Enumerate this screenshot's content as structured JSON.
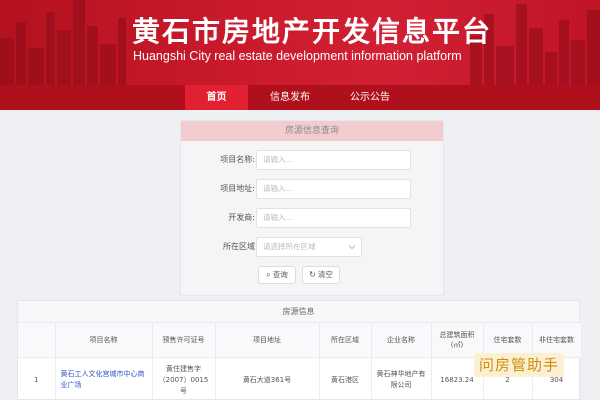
{
  "header": {
    "title": "黄石市房地产开发信息平台",
    "subtitle": "Huangshi City real estate development information platform"
  },
  "nav": {
    "items": [
      {
        "label": "首页",
        "active": true
      },
      {
        "label": "信息发布",
        "active": false
      },
      {
        "label": "公示公告",
        "active": false
      }
    ]
  },
  "search": {
    "title": "房源信息查询",
    "fields": [
      {
        "label": "项目名称:",
        "placeholder": "请输入..."
      },
      {
        "label": "项目地址:",
        "placeholder": "请输入..."
      },
      {
        "label": "开发商:",
        "placeholder": "请输入..."
      }
    ],
    "region": {
      "label": "所在区域",
      "placeholder": "请选择所在区域"
    },
    "query_button": "查询",
    "clear_button": "清空"
  },
  "results": {
    "title": "房源信息",
    "columns": [
      "",
      "项目名称",
      "预售许可证号",
      "项目地址",
      "所在区域",
      "企业名称",
      "总建筑面积(㎡)",
      "住宅套数",
      "非住宅套数"
    ],
    "rows": [
      {
        "index": "1",
        "name": "黄石工人文化宫城市中心商业广场",
        "license": "黄住建售字（2007）0015号",
        "address": "黄石大道361号",
        "district": "黄石港区",
        "company": "黄石神华地产有限公司",
        "area": "16823.24",
        "residential": "2",
        "non_residential": "304"
      }
    ]
  },
  "watermark": {
    "label": "问房管助手"
  },
  "colors": {
    "brand_red": "#c8192a",
    "nav_red": "#b0101c",
    "active_red": "#e32031",
    "link_blue": "#2f52c9"
  }
}
